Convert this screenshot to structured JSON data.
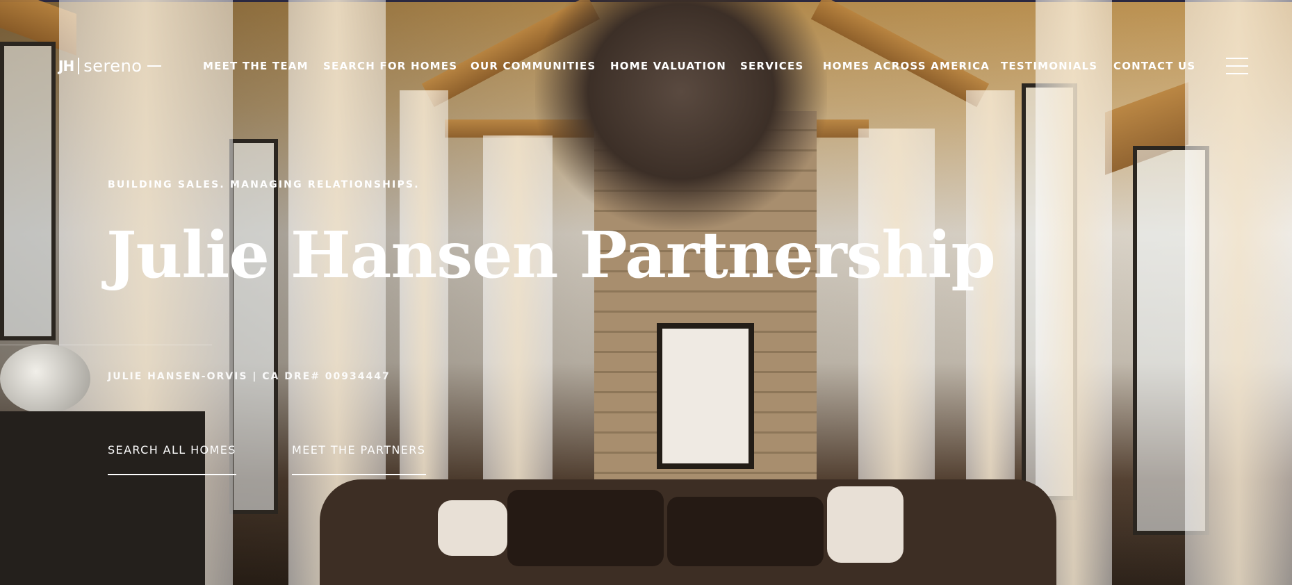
{
  "header": {
    "logo": {
      "mark": "JH",
      "name": "sereno"
    },
    "nav": [
      {
        "label": "MEET THE TEAM"
      },
      {
        "label": "SEARCH FOR HOMES"
      },
      {
        "label": "OUR COMMUNITIES"
      },
      {
        "label": "HOME VALUATION"
      },
      {
        "label": "SERVICES"
      },
      {
        "label": "HOMES ACROSS AMERICA"
      },
      {
        "label": "TESTIMONIALS"
      },
      {
        "label": "CONTACT US"
      }
    ],
    "menu_icon": "hamburger-menu-icon"
  },
  "hero": {
    "tagline": "BUILDING SALES. MANAGING RELATIONSHIPS.",
    "title": "Julie Hansen Partnership",
    "license": "JULIE HANSEN-ORVIS | CA DRE# 00934447",
    "buttons": [
      {
        "label": "SEARCH ALL HOMES"
      },
      {
        "label": "MEET THE PARTNERS"
      }
    ]
  },
  "colors": {
    "text": "#ffffff",
    "wood": "#b9833e",
    "dark": "#24201c"
  }
}
